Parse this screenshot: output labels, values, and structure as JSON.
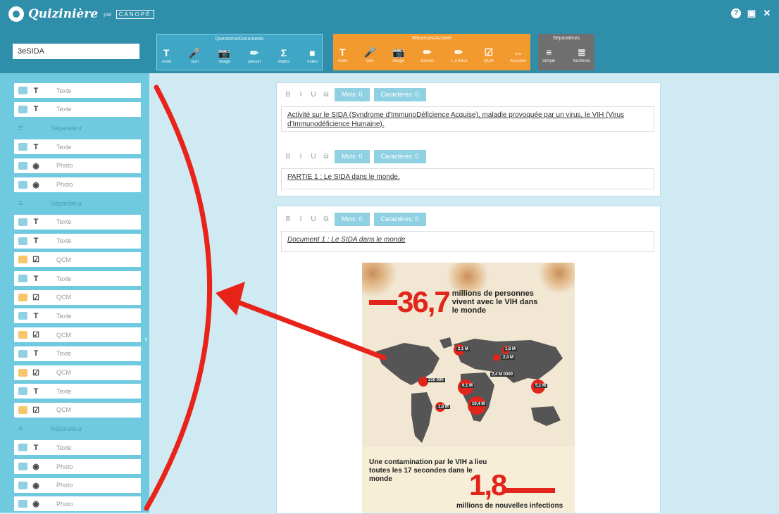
{
  "app": {
    "logo": "Quizinière",
    "logo_sub": "par",
    "partner": "CANOPÉ"
  },
  "top_icons": [
    "help-icon",
    "save-icon",
    "close-icon"
  ],
  "title_input": {
    "value": "3eSIDA"
  },
  "groups": {
    "questions": {
      "title": "Questions/Documents",
      "buttons": [
        {
          "icon": "T",
          "label": "Texte"
        },
        {
          "icon": "🎤",
          "label": "Son"
        },
        {
          "icon": "📷",
          "label": "Image"
        },
        {
          "icon": "✏",
          "label": "Dessin"
        },
        {
          "icon": "Σ",
          "label": "Maths"
        },
        {
          "icon": "■",
          "label": "Vidéo"
        }
      ]
    },
    "reponses": {
      "title": "Réponses/Activité",
      "buttons": [
        {
          "icon": "T",
          "label": "Texte"
        },
        {
          "icon": "🎤",
          "label": "Son"
        },
        {
          "icon": "📷",
          "label": "Image"
        },
        {
          "icon": "✏",
          "label": "Dessin"
        },
        {
          "icon": "✏",
          "label": "T. à trous"
        },
        {
          "icon": "☑",
          "label": "QCM"
        },
        {
          "icon": "↔",
          "label": "Associer"
        }
      ]
    },
    "separateurs": {
      "title": "Séparateurs",
      "buttons": [
        {
          "icon": "≡",
          "label": "Simple"
        },
        {
          "icon": "≣",
          "label": "Numéros"
        }
      ]
    }
  },
  "sidebar_items": [
    {
      "kind": "text",
      "badge": "blue",
      "type": "T",
      "label": "Texte"
    },
    {
      "kind": "text",
      "badge": "blue",
      "type": "T",
      "label": "Texte"
    },
    {
      "kind": "sep",
      "label": "Séparateur"
    },
    {
      "kind": "text",
      "badge": "blue",
      "type": "T",
      "label": "Texte"
    },
    {
      "kind": "photo",
      "badge": "blue",
      "type": "◉",
      "label": "Photo"
    },
    {
      "kind": "photo",
      "badge": "blue",
      "type": "◉",
      "label": "Photo"
    },
    {
      "kind": "sep",
      "label": "Séparateur"
    },
    {
      "kind": "text",
      "badge": "blue",
      "type": "T",
      "label": "Texte"
    },
    {
      "kind": "text",
      "badge": "blue",
      "type": "T",
      "label": "Texte"
    },
    {
      "kind": "qcm",
      "badge": "orange",
      "type": "☑",
      "label": "QCM"
    },
    {
      "kind": "text",
      "badge": "blue",
      "type": "T",
      "label": "Texte"
    },
    {
      "kind": "qcm",
      "badge": "orange",
      "type": "☑",
      "label": "QCM"
    },
    {
      "kind": "text",
      "badge": "blue",
      "type": "T",
      "label": "Texte"
    },
    {
      "kind": "qcm",
      "badge": "orange",
      "type": "☑",
      "label": "QCM"
    },
    {
      "kind": "text",
      "badge": "blue",
      "type": "T",
      "label": "Texte"
    },
    {
      "kind": "qcm",
      "badge": "orange",
      "type": "☑",
      "label": "QCM"
    },
    {
      "kind": "text",
      "badge": "blue",
      "type": "T",
      "label": "Texte"
    },
    {
      "kind": "qcm",
      "badge": "orange",
      "type": "☑",
      "label": "QCM"
    },
    {
      "kind": "sep",
      "label": "Séparateur"
    },
    {
      "kind": "text",
      "badge": "blue",
      "type": "T",
      "label": "Texte"
    },
    {
      "kind": "photo",
      "badge": "blue",
      "type": "◉",
      "label": "Photo"
    },
    {
      "kind": "photo",
      "badge": "blue",
      "type": "◉",
      "label": "Photo"
    },
    {
      "kind": "photo",
      "badge": "blue",
      "type": "◉",
      "label": "Photo"
    }
  ],
  "editor": {
    "tools": [
      "B",
      "I",
      "U",
      "⧉"
    ],
    "words": "Mots: 0",
    "chars": "Caractères: 0",
    "block1": "Activité sur le SIDA (Syndrome d'ImmunoDéficience Acquise), maladie provoquée par un virus, le VIH (Virus d'Immunodéficience Humaine).",
    "block2": "PARTIE 1 : Le SIDA dans le monde.",
    "block3": "Document 1 : Le SIDA dans le monde"
  },
  "infographic": {
    "number1": "36,7",
    "text1": "millions de personnes vivent avec le VIH dans le monde",
    "regions": [
      "2,1 M",
      "1,6 M",
      "2,4 M",
      "2,4 M 0000",
      "210 000",
      "6,1 M",
      "5,1 M",
      "1,8 M",
      "19,4 M"
    ],
    "sentence": "Une contamination par le VIH a lieu toutes les 17 secondes dans le monde",
    "number2": "1,8",
    "text2": "millions de nouvelles infections"
  },
  "colors": {
    "topbar": "#2f8fab",
    "sidebar": "#6fcae0",
    "orange": "#f39a2e",
    "annotation": "#e8241a"
  }
}
